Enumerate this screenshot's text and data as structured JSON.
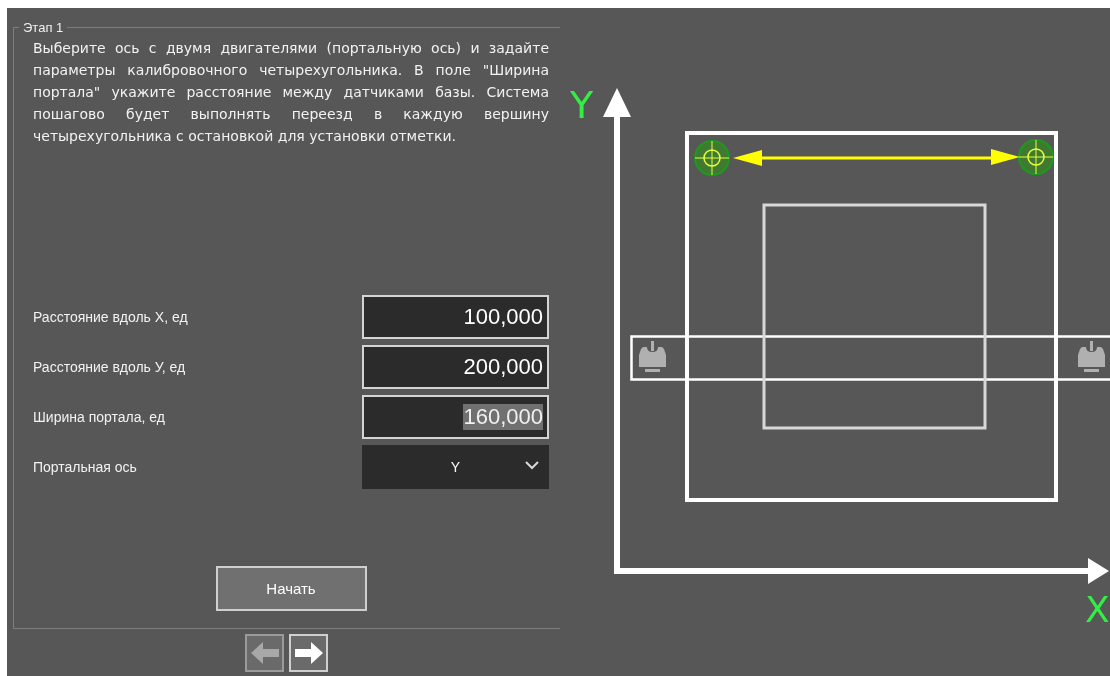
{
  "stage": {
    "title": "Этап 1",
    "description": "Выберите ось с двумя двигателями (портальную ось) и задайте параметры калибровочного четырехугольника. В поле \"Ширина портала\" укажите расстояние между датчиками базы. Система пошагово будет выполнять переезд в каждую вершину четырехугольника с остановкой для установки отметки."
  },
  "fields": [
    {
      "kind": "input",
      "label": "Расстояние вдоль X, ед",
      "value": "100,000",
      "highlighted": false
    },
    {
      "kind": "input",
      "label": "Расстояние вдоль У, ед",
      "value": "200,000",
      "highlighted": false
    },
    {
      "kind": "input",
      "label": "Ширина портала, ед",
      "value": "160,000",
      "highlighted": true
    },
    {
      "kind": "select",
      "label": "Портальная ось",
      "value": "Y"
    }
  ],
  "start_button": {
    "label": "Начать"
  },
  "navigation": [
    {
      "kind": "back",
      "disabled": true
    },
    {
      "kind": "forward",
      "disabled": false
    }
  ],
  "diagram": {
    "y_axis_label": "Y",
    "x_axis_label": "X"
  }
}
